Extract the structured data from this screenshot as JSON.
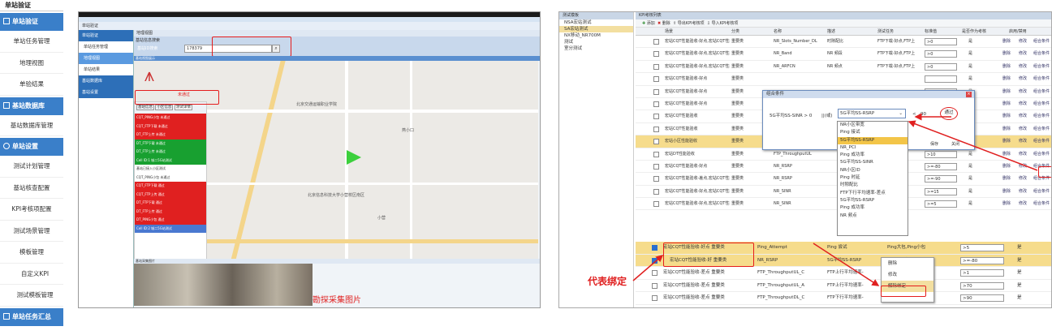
{
  "menu": {
    "title": "单站验证",
    "groups": [
      {
        "label": "单站验证",
        "items": [
          "单站任务管理",
          "地理视图",
          "单验结果"
        ]
      },
      {
        "label": "基站数据库",
        "items": [
          "基站数据库管理"
        ]
      },
      {
        "label": "单站设置",
        "items": [
          "测试计划管理",
          "基站核查配置",
          "KPI考核项配置",
          "测试场景管理",
          "模板管理",
          "自定义KPI",
          "测试模板管理"
        ]
      },
      {
        "label": "单站任务汇总",
        "items": []
      }
    ]
  },
  "panel1": {
    "side_title": "单站验证",
    "side_groups": [
      "单站验证",
      "单站任务管理",
      "地理视图",
      "单站结果",
      "基站数据库",
      "基站设置"
    ],
    "map_header": "地理视图",
    "search_label": "基站信息搜索",
    "search_mode": "基站ID搜索",
    "search_value": "178379",
    "view_header": "基站视图展示",
    "tabs": [
      "基站信息",
      "小区信息",
      "测试详情"
    ],
    "not_passed": "未通过",
    "rows": [
      {
        "t": "CQT_PING小包 未通过",
        "c": "red"
      },
      {
        "t": "CQT_FTP下载 未通过",
        "c": "red"
      },
      {
        "t": "DT_FTP上传 未通过",
        "c": "red"
      },
      {
        "t": "DT_FTP下载 未通过",
        "c": "grn"
      },
      {
        "t": "DT_FTP上传 未通过",
        "c": "grn"
      },
      {
        "t": "Cell ID:1 城二5G站测试",
        "c": "grn"
      },
      {
        "t": "基站已接入小区测试",
        "c": "wh"
      },
      {
        "t": "CQT_PING小包 未通过",
        "c": "wh"
      },
      {
        "t": "CQT_FTP下载 通过",
        "c": "red"
      },
      {
        "t": "CQT_FTP上传 通过",
        "c": "red"
      },
      {
        "t": "DT_FTP下载 通过",
        "c": "red"
      },
      {
        "t": "DT_FTP上传 通过",
        "c": "red"
      },
      {
        "t": "DT_PING小包 通过",
        "c": "red"
      },
      {
        "t": "Cell ID:2 城二5G站测试",
        "c": "blu"
      }
    ],
    "places": [
      "北京交通运输职业学院",
      "北京信息科技大学小营校区南区",
      "小营",
      "燕小口"
    ],
    "photo_header": "基站采集图片",
    "photo_caption": "勘探采集图片"
  },
  "panel2": {
    "tree_header": "测试模板",
    "tree": [
      "NSA宏站测试",
      "SA宏站测试",
      "NX移动_NR700M",
      "测试",
      "室分测试"
    ],
    "grid_header": "KPI考核列表",
    "toolbar": [
      "添加",
      "删除",
      "导出KPI考核项",
      "导入KPI考核项"
    ],
    "columns": [
      "场景",
      "分类",
      "名称",
      "描述",
      "测试任务",
      "标准值",
      "是否作为考核",
      "启用/禁用"
    ],
    "rows": [
      {
        "scene": "宏站CQT性能验收-好点,宏站CQT性能验收-中点",
        "cat": "重要类",
        "name": "NR_Slots_Number_DL",
        "desc": "时隙配比",
        "task": "FTP下载-好点,FTP上",
        "std": ">0",
        "yn": "是"
      },
      {
        "scene": "宏站CQT性能验收-好点,宏站CQT性能验收-中点",
        "cat": "重要类",
        "name": "NR_Band",
        "desc": "NR 频段",
        "task": "FTP下载-好点,FTP上",
        "std": ">0",
        "yn": "是"
      },
      {
        "scene": "宏站CQT性能验收-好点,宏站CQT性能验收-中点",
        "cat": "重要类",
        "name": "NR_ARFCN",
        "desc": "NR 频点",
        "task": "FTP下载-好点,FTP上",
        "std": ">0",
        "yn": "是"
      },
      {
        "scene": "宏站CQT性能验收-好点",
        "cat": "重要类",
        "name": "",
        "desc": "",
        "task": "",
        "std": "",
        "yn": "是"
      },
      {
        "scene": "宏站CQT性能验收-好点",
        "cat": "重要类",
        "name": "",
        "desc": "",
        "task": "",
        "std": "",
        "yn": "是"
      },
      {
        "scene": "宏站CQT性能验收-好点",
        "cat": "重要类",
        "name": "",
        "desc": "",
        "task": "",
        "std": "",
        "yn": "是"
      },
      {
        "scene": "宏站CQT性能验收",
        "cat": "重要类",
        "name": "",
        "desc": "",
        "task": "",
        "std": "",
        "yn": "是"
      },
      {
        "scene": "宏站CQT性能验收",
        "cat": "重要类",
        "name": "NR_RSRP",
        "desc": "",
        "task": "5G平均SS-",
        "std": ">0",
        "yn": "是"
      },
      {
        "scene": "宏站小区性能验收",
        "cat": "重要类",
        "name": "NR_SINR",
        "desc": "",
        "task": "5G平均SS-",
        "std": ">0",
        "yn": "是"
      },
      {
        "scene": "宏站DT性能验收",
        "cat": "重要类",
        "name": "FTP_ThroughputUL",
        "desc": "",
        "task": "FTP上传",
        "std": ">10",
        "yn": "是"
      },
      {
        "scene": "宏站CQT性能验收-好点",
        "cat": "重要类",
        "name": "NR_RSRP",
        "desc": "",
        "task": "FTP上传",
        "std": ">=-80",
        "yn": "是"
      },
      {
        "scene": "宏站CQT性能验收-差点,宏站CQT性能验收-中点",
        "cat": "重要类",
        "name": "NR_RSRP",
        "desc": "",
        "task": "FTP上传",
        "std": ">=-90",
        "yn": "是"
      },
      {
        "scene": "宏站CQT性能验收-好点,宏站CQT性能验收-中点",
        "cat": "重要类",
        "name": "NR_SINR",
        "desc": "",
        "task": "FTP上传",
        "std": ">=15",
        "yn": "是"
      },
      {
        "scene": "宏站CQT性能验收-好点,宏站CQT性能验收-中点",
        "cat": "重要类",
        "name": "NR_SINR",
        "desc": "",
        "task": "FTP上传",
        "std": ">=5",
        "yn": "是"
      }
    ],
    "actions": [
      "删除",
      "修改",
      "组合条件"
    ],
    "dialog": {
      "title": "组合条件",
      "left": "5G平均SS-SINR > 0",
      "op": "||(或)",
      "select": "5G平均SS-RSRP",
      "cmp": "<",
      "val": "-90",
      "badge": "通过",
      "save": "保存",
      "close": "关闭"
    },
    "dropdown": [
      "NR小区带宽",
      "Ping 接试",
      "5G平均SS-RSRP",
      "NR_PCI",
      "Ping 成功率",
      "5G平均SS-SINR",
      "NR小区ID",
      "Ping 时延",
      "时隙配比",
      "FTP下行平均速率-差点",
      "5G平均SS-RSRP",
      "Ping 成功率",
      "NR 频点"
    ],
    "lower_rows": [
      {
        "scene": "宏站CQT性能验收-好点 重要类",
        "name": "Ping_Attempt",
        "desc": "Ping 尝试",
        "task": "Ping大包,Ping小包",
        "std": ">5",
        "yn": "是",
        "checked": true,
        "sel": true
      },
      {
        "scene": "宏站CQT性能验收-好 重要类",
        "name": "NR_RSRP",
        "desc": "5G平均SS-RSRP",
        "task": "FTP上传-好点",
        "std": ">=-80",
        "yn": "是",
        "checked": true,
        "sel": true
      },
      {
        "scene": "宏站CQT性能验收-差点 重要类",
        "name": "FTP_ThroughputUL_C",
        "desc": "FTP上行平均速率-",
        "task": "",
        "std": ">1",
        "yn": "是",
        "checked": false,
        "sel": false
      },
      {
        "scene": "宏站CQT性能验收-差点 重要类",
        "name": "FTP_ThroughputUL_A",
        "desc": "FTP上行平均速率-",
        "task": "",
        "std": ">70",
        "yn": "是",
        "checked": false,
        "sel": false
      },
      {
        "scene": "宏站CQT性能验收-差点 重要类",
        "name": "FTP_ThroughputDL_C",
        "desc": "FTP下行平均速率-",
        "task": "",
        "std": ">90",
        "yn": "是",
        "checked": false,
        "sel": false
      }
    ],
    "context_menu": [
      "删除",
      "修改",
      "解除绑定"
    ],
    "annotation": "代表绑定"
  }
}
